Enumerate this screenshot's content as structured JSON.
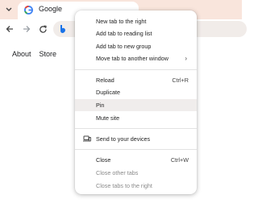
{
  "tab": {
    "title": "Google"
  },
  "page": {
    "links": [
      "About",
      "Store"
    ]
  },
  "menu": {
    "items": [
      {
        "label": "New tab to the right",
        "shortcut": "",
        "submenu": false,
        "state": "normal"
      },
      {
        "label": "Add tab to reading list",
        "shortcut": "",
        "submenu": false,
        "state": "normal"
      },
      {
        "label": "Add tab to new group",
        "shortcut": "",
        "submenu": false,
        "state": "normal"
      },
      {
        "label": "Move tab to another window",
        "shortcut": "",
        "submenu": true,
        "state": "normal"
      },
      {
        "label": "Reload",
        "shortcut": "Ctrl+R",
        "submenu": false,
        "state": "normal"
      },
      {
        "label": "Duplicate",
        "shortcut": "",
        "submenu": false,
        "state": "normal"
      },
      {
        "label": "Pin",
        "shortcut": "",
        "submenu": false,
        "state": "highlighted"
      },
      {
        "label": "Mute site",
        "shortcut": "",
        "submenu": false,
        "state": "normal"
      },
      {
        "label": "Send to your devices",
        "shortcut": "",
        "submenu": false,
        "state": "normal"
      },
      {
        "label": "Close",
        "shortcut": "Ctrl+W",
        "submenu": false,
        "state": "normal"
      },
      {
        "label": "Close other tabs",
        "shortcut": "",
        "submenu": false,
        "state": "disabled"
      },
      {
        "label": "Close tabs to the right",
        "shortcut": "",
        "submenu": false,
        "state": "disabled"
      }
    ],
    "submenu_arrow": "›"
  },
  "colors": {
    "tabstrip": "#f9e5dc",
    "menu_highlight": "#f0edec",
    "disabled_text": "#8a8a8a"
  }
}
